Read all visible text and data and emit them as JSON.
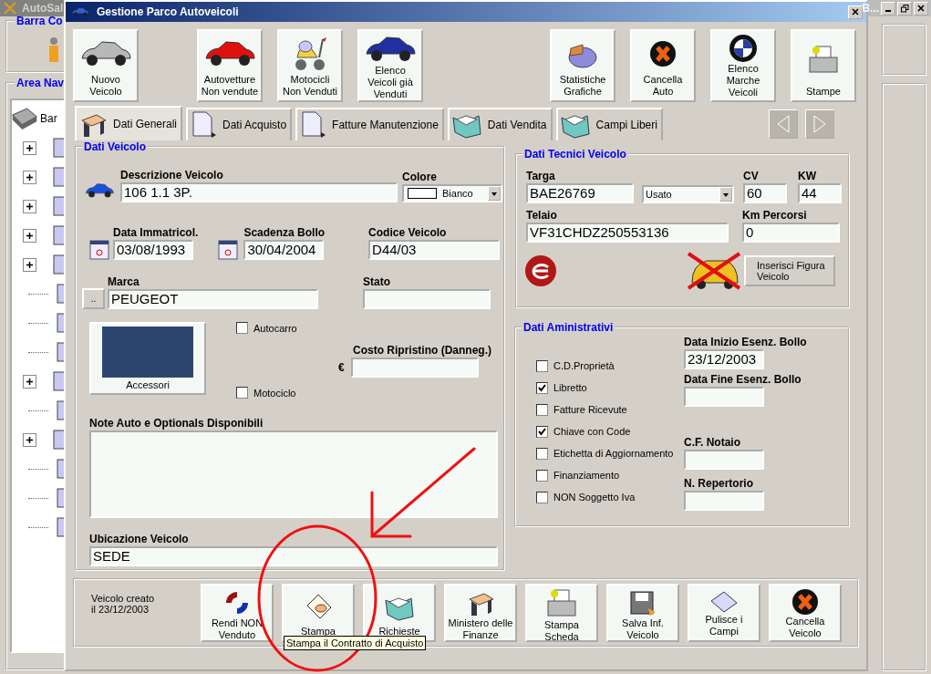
{
  "background_app": {
    "title": "AutoSal",
    "title_right": "B...",
    "command_bar": {
      "title": "Barra Co"
    },
    "navigation": {
      "title": "Area Nav",
      "tree": {
        "label": "Bar",
        "children": [
          {
            "expandable": true
          },
          {
            "expandable": true
          },
          {
            "expandable": true
          },
          {
            "expandable": true
          },
          {
            "expandable": true
          },
          {
            "expandable": false
          },
          {
            "expandable": false
          },
          {
            "expandable": false
          },
          {
            "expandable": true
          },
          {
            "expandable": false
          },
          {
            "expandable": true
          },
          {
            "expandable": false
          },
          {
            "expandable": false
          },
          {
            "expandable": false
          }
        ]
      }
    }
  },
  "dialog": {
    "title": "Gestione Parco Autoveicoli",
    "toolbar_left": [
      {
        "label": "Nuovo\nVeicolo"
      },
      {
        "label": "Autovetture\nNon vendute"
      },
      {
        "label": "Motocicli\nNon Venduti"
      },
      {
        "label": "Elenco\nVeicoli già\nVenduti"
      }
    ],
    "toolbar_right": [
      {
        "label": "Statistiche\nGrafiche"
      },
      {
        "label": "Cancella\nAuto"
      },
      {
        "label": "Elenco\nMarche\nVeicoli"
      },
      {
        "label": "Stampe"
      }
    ],
    "tabs": [
      {
        "label": "Dati Generali",
        "selected": true
      },
      {
        "label": "Dati Acquisto",
        "selected": false
      },
      {
        "label": "Fatture Manutenzione",
        "selected": false
      },
      {
        "label": "Dati Vendita",
        "selected": false
      },
      {
        "label": "Campi Liberi",
        "selected": false
      }
    ],
    "vehicle": {
      "title": "Dati Veicolo",
      "description": {
        "label": "Descrizione Veicolo",
        "value": "106 1.1 3P."
      },
      "color": {
        "label": "Colore",
        "value": "Bianco"
      },
      "registration_date": {
        "label": "Data Immatricol.",
        "value": "03/08/1993"
      },
      "tax_expiry": {
        "label": "Scadenza Bollo",
        "value": "30/04/2004"
      },
      "vehicle_code": {
        "label": "Codice Veicolo",
        "value": "D44/03"
      },
      "brand": {
        "label": "Marca",
        "value": "PEUGEOT",
        "button": ".."
      },
      "status": {
        "label": "Stato"
      },
      "accessories_button": "Accessori",
      "types": [
        {
          "label": "Autocarro",
          "checked": false
        },
        {
          "label": "Motociclo",
          "checked": false
        }
      ],
      "repair_cost": {
        "label": "Costo Ripristino (Danneg.)",
        "currency": "€"
      },
      "notes": {
        "label": "Note Auto e Optionals Disponibili"
      },
      "location": {
        "label": "Ubicazione Veicolo",
        "value": "SEDE"
      }
    },
    "technical": {
      "title": "Dati Tecnici Veicolo",
      "plate": {
        "label": "Targa",
        "value": "BAE26769"
      },
      "condition": {
        "value": "Usato"
      },
      "cv": {
        "label": "CV",
        "value": "60"
      },
      "kw": {
        "label": "KW",
        "value": "44"
      },
      "chassis": {
        "label": "Telaio",
        "value": "VF31CHDZ250553136"
      },
      "km": {
        "label": "Km Percorsi",
        "value": "0"
      },
      "image_button": "Inserisci Figura\nVeicolo"
    },
    "administrative": {
      "title": "Dati Aministrativi",
      "checks": [
        {
          "label": "C.D.Proprietà",
          "checked": false
        },
        {
          "label": "Libretto",
          "checked": true
        },
        {
          "label": "Fatture Ricevute",
          "checked": false
        },
        {
          "label": "Chiave con Code",
          "checked": true
        },
        {
          "label": "Etichetta di Aggiornamento",
          "checked": false
        },
        {
          "label": "Finanziamento",
          "checked": false
        },
        {
          "label": "NON Soggetto Iva",
          "checked": false
        }
      ],
      "fields": [
        {
          "label": "Data Inizio Esenz. Bollo",
          "value": "23/12/2003"
        },
        {
          "label": "Data Fine Esenz. Bollo"
        },
        {
          "label": "C.F. Notaio"
        },
        {
          "label": "N. Repertorio"
        }
      ]
    },
    "footer": {
      "created": "Veicolo creato\nil 23/12/2003",
      "buttons": [
        {
          "label": "Rendi NON\nVenduto"
        },
        {
          "label": "Stampa"
        },
        {
          "label": "Richieste"
        },
        {
          "label": "Ministero delle\nFinanze"
        },
        {
          "label": "Stampa\nScheda"
        },
        {
          "label": "Salva Inf.\nVeicolo"
        },
        {
          "label": "Pulisce i\nCampi"
        },
        {
          "label": "Cancella\nVeicolo"
        }
      ]
    },
    "tooltip": "Stampa il Contratto di Acquisto"
  }
}
